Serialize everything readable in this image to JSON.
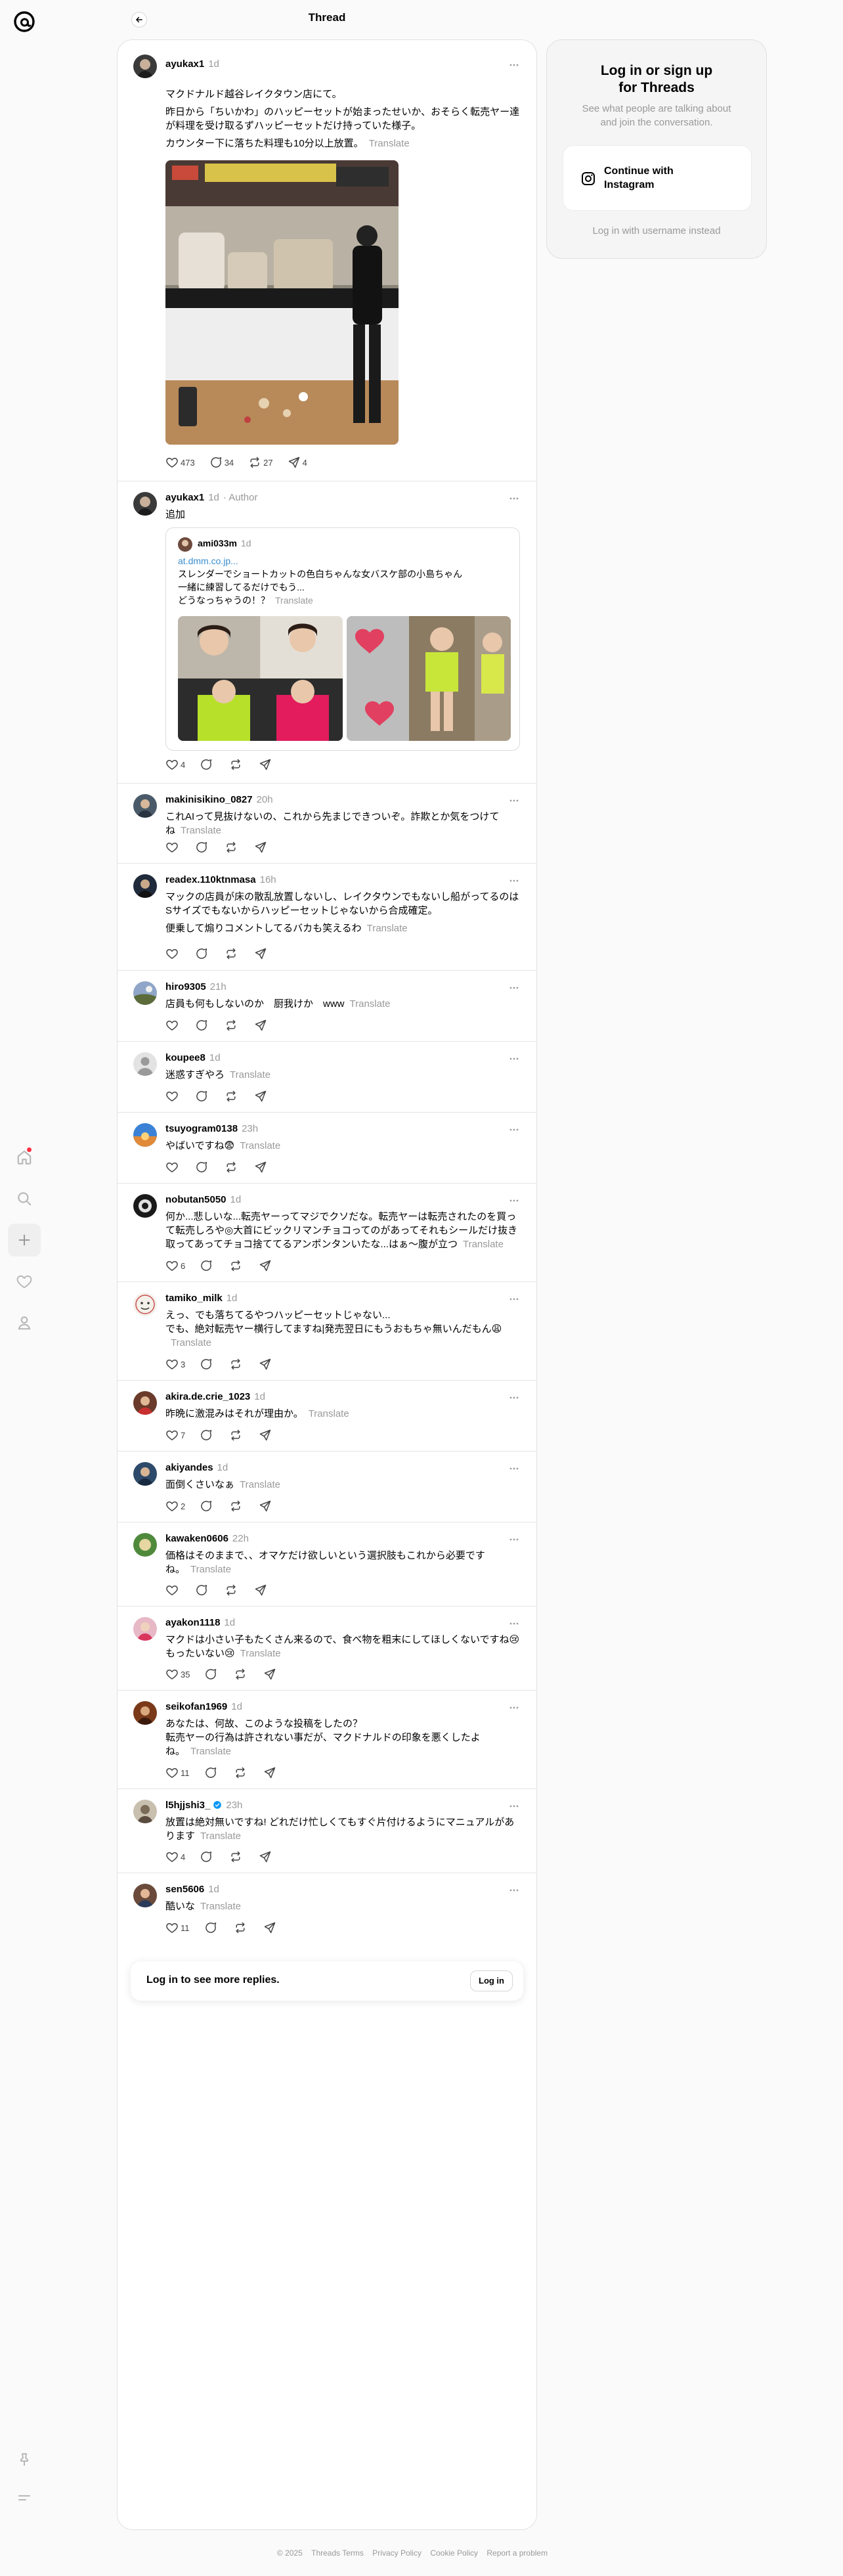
{
  "header": {
    "title": "Thread"
  },
  "nav": {
    "items": [
      "home",
      "search",
      "create",
      "activity",
      "profile"
    ],
    "bottom": [
      "pin",
      "menu"
    ]
  },
  "main_post": {
    "user": "ayukax1",
    "time": "1d",
    "line1": "マクドナルド越谷レイクタウン店にて。",
    "line2": "昨日から「ちいかわ」のハッピーセットが始まったせいか、おそらく転売ヤー達が料理を受け取るずハッピーセットだけ持っていた様子。",
    "line3": "カウンター下に落ちた料理も10分以上放置。",
    "translate": "Translate",
    "likes": "473",
    "replies": "34",
    "reposts": "27",
    "shares": "4"
  },
  "author_post": {
    "user": "ayukax1",
    "time": "1d",
    "badge": "Author",
    "text": "追加",
    "likes": "4",
    "quote": {
      "user": "ami033m",
      "time": "1d",
      "link": "at.dmm.co.jp...",
      "line1": "スレンダーでショートカットの色白ちゃんな女バスケ部の小島ちゃん",
      "line2": "一緒に練習してるだけでもう...",
      "line3": "どうなっちゃうの！？",
      "translate": "Translate"
    }
  },
  "replies": [
    {
      "user": "makinisikino_0827",
      "time": "20h",
      "line1": "これAIって見抜けないの、これから先まじできついぞ。詐欺とか気をつけて",
      "line2": "ね",
      "translate": "Translate",
      "likes": ""
    },
    {
      "user": "readex.110ktnmasa",
      "time": "16h",
      "line1": "マックの店員が床の散乱放置しないし、レイクタウンでもないし船がってるのはSサイズでもないからハッピーセットじゃないから合成確定。",
      "line2": "便乗して煽りコメントしてるバカも笑えるわ",
      "translate": "Translate",
      "likes": ""
    },
    {
      "user": "hiro9305",
      "time": "21h",
      "line1": "店員も何もしないのか　厨我けか　www",
      "translate": "Translate",
      "likes": ""
    },
    {
      "user": "koupee8",
      "time": "1d",
      "line1": "迷惑すぎやろ",
      "translate": "Translate",
      "likes": ""
    },
    {
      "user": "tsuyogram0138",
      "time": "23h",
      "line1": "やばいですね😨",
      "translate": "Translate",
      "likes": ""
    },
    {
      "user": "nobutan5050",
      "time": "1d",
      "line1": "何か...悲しいな...転売ヤーってマジでクソだな。転売ヤーは転売されたのを買って転売しろや◎大首にビックリマンチョコってのがあってそれもシールだけ抜き取ってあってチョコ捨ててるアンポンタンいたな...はぁ〜腹が立つ",
      "translate": "Translate",
      "likes": "6"
    },
    {
      "user": "tamiko_milk",
      "time": "1d",
      "line1": "えっ、でも落ちてるやつハッピーセットじゃない...",
      "line2": "でも、絶対転売ヤー横行してますね|発売翌日にもうおもちゃ無いんだもん😩",
      "translate": "Translate",
      "likes": "3"
    },
    {
      "user": "akira.de.crie_1023",
      "time": "1d",
      "line1": "昨晩に激混みはそれが理由か。",
      "translate": "Translate",
      "likes": "7"
    },
    {
      "user": "akiyandes",
      "time": "1d",
      "line1": "面倒くさいなぁ",
      "translate": "Translate",
      "likes": "2"
    },
    {
      "user": "kawaken0606",
      "time": "22h",
      "line1": "価格はそのままで、、オマケだけ欲しいという選択肢もこれから必要です",
      "line2": "ね。",
      "translate": "Translate",
      "likes": ""
    },
    {
      "user": "ayakon1118",
      "time": "1d",
      "line1": "マクドは小さい子もたくさん来るので、食べ物を粗末にしてほしくないですね😢",
      "line2": "もったいない😢",
      "translate": "Translate",
      "likes": "35"
    },
    {
      "user": "seikofan1969",
      "time": "1d",
      "line1": "あなたは、何故、このような投稿をしたの？",
      "line2": "転売ヤーの行為は許されない事だが、マクドナルドの印象を悪くしたよ",
      "line3": "ね。",
      "translate": "Translate",
      "likes": "11"
    },
    {
      "user": "l5hjjshi3_",
      "time": "23h",
      "line1": "放置は絶対無いですね! どれだけ忙しくてもすぐ片付けるようにマニュアルがあります",
      "translate": "Translate",
      "likes": "4"
    },
    {
      "user": "sen5606",
      "time": "1d",
      "line1": "酷いな",
      "translate": "Translate",
      "likes": "11"
    }
  ],
  "login_bar": {
    "text": "Log in to see more replies.",
    "button": "Log in"
  },
  "sidebar": {
    "title_line1": "Log in or sign up",
    "title_line2": "for Threads",
    "sub_line1": "See what people are talking about",
    "sub_line2": "and join the conversation.",
    "ig_line1": "Continue with",
    "ig_line2": "Instagram",
    "alt_login": "Log in with username instead"
  },
  "footer": [
    "© 2025",
    "Threads Terms",
    "Privacy Policy",
    "Cookie Policy",
    "Report a problem"
  ],
  "colors": {
    "accent": "#000000",
    "muted": "#999999",
    "link": "#3a8fd0",
    "notification": "#ff3040",
    "verified": "#0095f6"
  }
}
